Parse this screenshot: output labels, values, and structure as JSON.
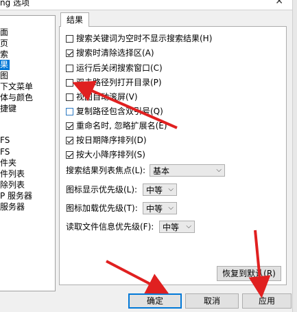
{
  "window": {
    "title": "ng 选项",
    "close": "✕"
  },
  "tree": {
    "items": [
      {
        "label": "面",
        "selected": false
      },
      {
        "label": "页",
        "selected": false
      },
      {
        "label": "索",
        "selected": false
      },
      {
        "label": "果",
        "selected": true
      },
      {
        "label": "图",
        "selected": false
      },
      {
        "label": "下文菜单",
        "selected": false
      },
      {
        "label": "体与颜色",
        "selected": false
      },
      {
        "label": "捷键",
        "selected": false
      },
      {
        "label": "FS",
        "selected": false
      },
      {
        "label": "FS",
        "selected": false
      },
      {
        "label": "件夹",
        "selected": false
      },
      {
        "label": "件列表",
        "selected": false
      },
      {
        "label": "除列表",
        "selected": false
      },
      {
        "label": "P 服务器",
        "selected": false
      },
      {
        "label": "服务器",
        "selected": false
      }
    ]
  },
  "tab": {
    "label": "结果"
  },
  "options": [
    {
      "label": "搜索关键词为空时不显示搜索结果(H)",
      "checked": false
    },
    {
      "label": "搜索时清除选择区(A)",
      "checked": true
    },
    {
      "label": "运行后关闭搜索窗口(C)",
      "checked": false
    },
    {
      "label": "双击路径列打开目录(P)",
      "checked": false
    },
    {
      "label": "视图自动滚屏(V)",
      "checked": false
    },
    {
      "label": "复制路径包含双引号(Q)",
      "checked": false
    },
    {
      "label": "重命名时, 忽略扩展名(E)",
      "checked": true
    },
    {
      "label": "按日期降序排列(D)",
      "checked": true
    },
    {
      "label": "按大小降序排列(S)",
      "checked": true
    }
  ],
  "fields": [
    {
      "label": "搜索结果列表焦点(L):",
      "value": "基本"
    },
    {
      "label": "图标显示优先级(L):",
      "value": "中等"
    },
    {
      "label": "图标加载优先级(T):",
      "value": "中等"
    },
    {
      "label": "读取文件信息优先级(F):",
      "value": "中等"
    }
  ],
  "buttons": {
    "restore": "恢复到默认(R)",
    "ok": "确定",
    "cancel": "取消",
    "apply": "应用"
  },
  "colors": {
    "selection": "#0078d7",
    "annotation_arrow": "#e02020"
  }
}
